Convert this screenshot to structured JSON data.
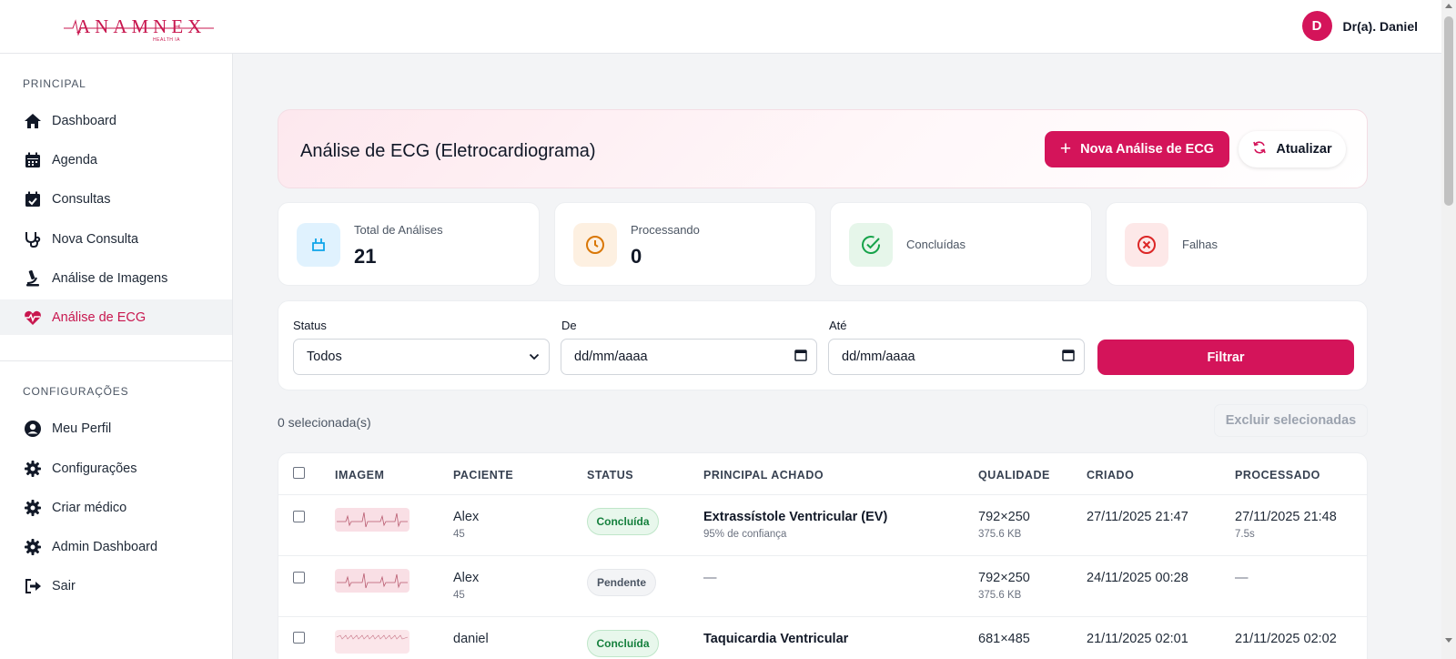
{
  "brand": {
    "logo_text": "ANAMNEX",
    "logo_sub": "HEALTH IA"
  },
  "user": {
    "initial": "D",
    "name": "Dr(a). Daniel"
  },
  "sidebar": {
    "section_principal": "PRINCIPAL",
    "items": [
      {
        "label": "Dashboard",
        "icon": "home-icon"
      },
      {
        "label": "Agenda",
        "icon": "calendar-icon"
      },
      {
        "label": "Consultas",
        "icon": "calendar-check-icon"
      },
      {
        "label": "Nova Consulta",
        "icon": "stethoscope-icon"
      },
      {
        "label": "Análise de Imagens",
        "icon": "microscope-icon"
      },
      {
        "label": "Análise de ECG",
        "icon": "heart-pulse-icon",
        "active": true
      }
    ],
    "section_config": "CONFIGURAÇÕES",
    "config_items": [
      {
        "label": "Meu Perfil",
        "icon": "user-circle-icon"
      },
      {
        "label": "Configurações",
        "icon": "gear-icon"
      },
      {
        "label": "Criar médico",
        "icon": "gear-icon"
      },
      {
        "label": "Admin Dashboard",
        "icon": "gear-icon"
      },
      {
        "label": "Sair",
        "icon": "logout-icon"
      }
    ]
  },
  "header": {
    "title": "Análise de ECG (Eletrocardiograma)",
    "new_button": "Nova Análise de ECG",
    "refresh_button": "Atualizar"
  },
  "stats": [
    {
      "label": "Total de Análises",
      "value": "21",
      "color": "#0ea5e9"
    },
    {
      "label": "Processando",
      "value": "0",
      "color": "#d97706"
    },
    {
      "label": "Concluídas",
      "value": "",
      "color": "#16a34a"
    },
    {
      "label": "Falhas",
      "value": "",
      "color": "#dc2626"
    }
  ],
  "filters": {
    "status_label": "Status",
    "status_value": "Todos",
    "from_label": "De",
    "from_placeholder": "dd/mm/aaaa",
    "to_label": "Até",
    "to_placeholder": "dd/mm/aaaa",
    "filter_button": "Filtrar"
  },
  "selection": {
    "count_text": "0 selecionada(s)",
    "delete_button": "Excluir selecionadas"
  },
  "table": {
    "headers": [
      "IMAGEM",
      "PACIENTE",
      "STATUS",
      "PRINCIPAL ACHADO",
      "QUALIDADE",
      "CRIADO",
      "PROCESSADO"
    ],
    "rows": [
      {
        "patient": "Alex",
        "age": "45",
        "status": "Concluída",
        "status_kind": "ok",
        "finding": "Extrassístole Ventricular (EV)",
        "confidence": "95% de confiança",
        "quality": "792×250",
        "size": "375.6 KB",
        "created": "27/11/2025 21:47",
        "processed": "27/11/2025 21:48",
        "duration": "7.5s"
      },
      {
        "patient": "Alex",
        "age": "45",
        "status": "Pendente",
        "status_kind": "pend",
        "finding": "—",
        "confidence": "",
        "quality": "792×250",
        "size": "375.6 KB",
        "created": "24/11/2025 00:28",
        "processed": "—",
        "duration": ""
      },
      {
        "patient": "daniel",
        "age": "",
        "status": "Concluída",
        "status_kind": "ok",
        "finding": "Taquicardia Ventricular",
        "confidence": "",
        "quality": "681×485",
        "size": "",
        "created": "21/11/2025 02:01",
        "processed": "21/11/2025 02:02",
        "duration": ""
      }
    ]
  },
  "colors": {
    "accent": "#d4145a",
    "sidebar_active": "#c8174f"
  }
}
